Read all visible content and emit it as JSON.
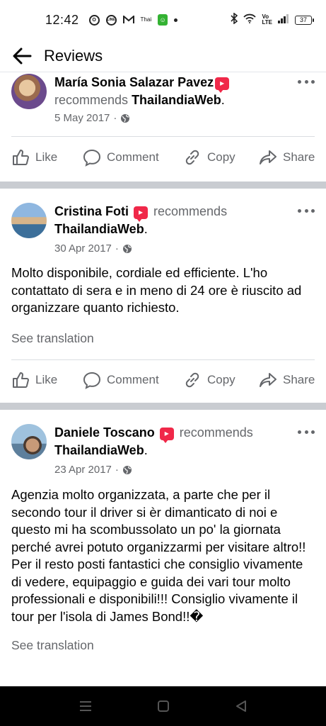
{
  "status_bar": {
    "time": "12:42",
    "left_icons": [
      "opera-icon",
      "line-icon",
      "gmail-icon",
      "thai-icon",
      "android-icon",
      "dot-icon"
    ],
    "line_label": "LINE",
    "thai_label": "Thai",
    "volte_label": "Vo\nLTE",
    "battery": "37"
  },
  "header": {
    "title": "Reviews",
    "back_icon": "arrow-left-icon"
  },
  "actions": {
    "like": "Like",
    "comment": "Comment",
    "copy": "Copy",
    "share": "Share"
  },
  "reviews": [
    {
      "author": "María Sonia Salazar Pavez",
      "verb": "recommends",
      "page": "ThailandiaWeb",
      "punct": ".",
      "date": "5 May 2017",
      "sep": " · "
    },
    {
      "author": "Cristina Foti",
      "verb": "recommends",
      "page": "ThailandiaWeb",
      "punct": ".",
      "date": "30 Apr 2017",
      "sep": " · ",
      "text": "Molto disponibile, cordiale ed efficiente. L'ho contattato di sera e in meno di 24 ore è riuscito ad organizzare quanto richiesto.",
      "translation": "See translation"
    },
    {
      "author": "Daniele Toscano",
      "verb": "recommends",
      "page": "ThailandiaWeb",
      "punct": ".",
      "date": "23 Apr 2017",
      "sep": " · ",
      "text": "Agenzia molto organizzata, a parte che per il secondo tour il driver si èr dimanticato di noi e questo mi ha scombussolato un po' la giornata perché avrei potuto organizzarmi per visitare altro!! Per il resto posti fantastici che consiglio vivamente di vedere, equipaggio e guida dei vari tour molto professionali e disponibili!!! Consiglio vivamente il tour per l'isola di James Bond!!�",
      "translation": "See translation"
    }
  ],
  "colors": {
    "text": "#050505",
    "secondary": "#65676b",
    "badge": "#f02849",
    "separator": "#c9ccd1"
  }
}
